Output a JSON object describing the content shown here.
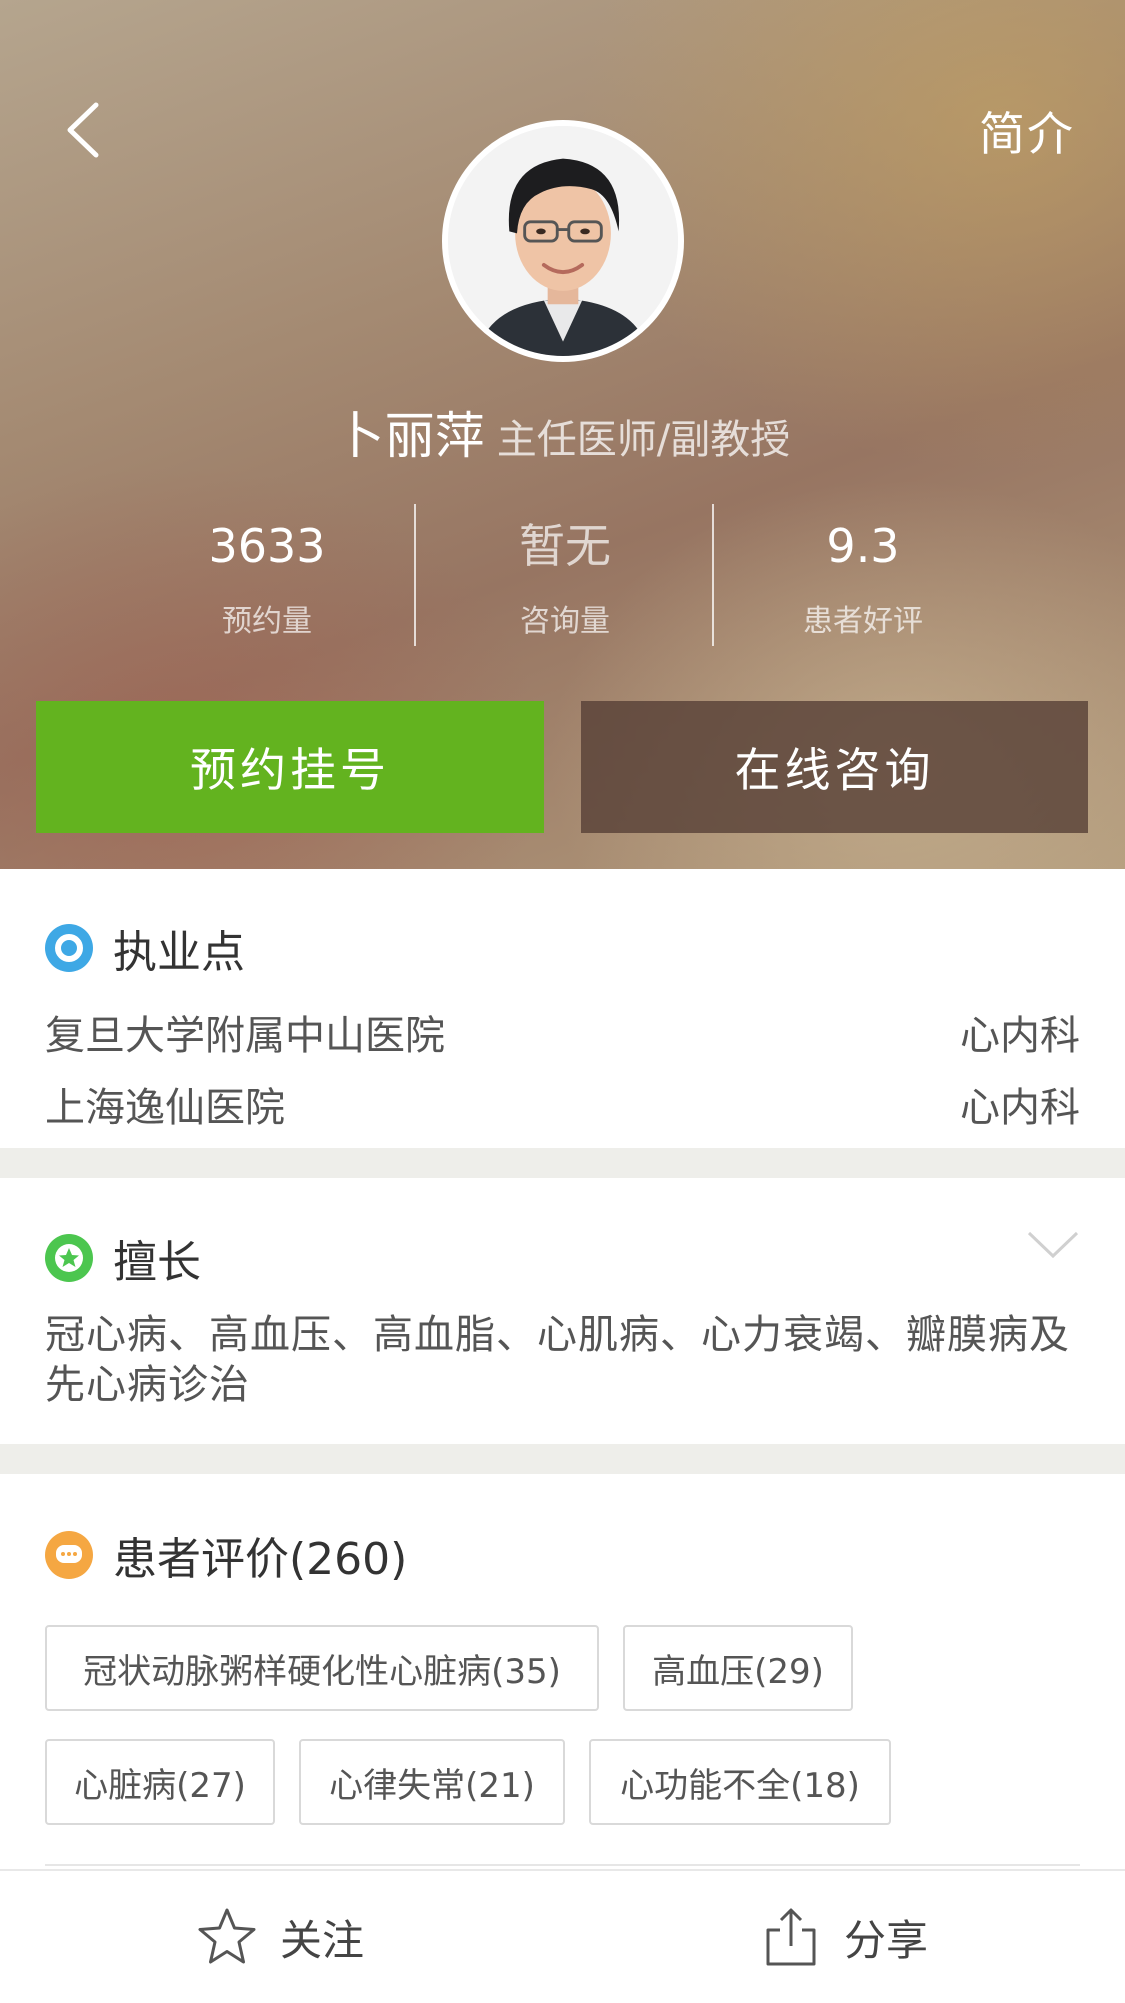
{
  "header": {
    "intro_label": "简介",
    "doctor_name": "卜丽萍",
    "doctor_title": "主任医师/副教授",
    "stats": [
      {
        "value": "3633",
        "label": "预约量"
      },
      {
        "value": "暂无",
        "label": "咨询量"
      },
      {
        "value": "9.3",
        "label": "患者好评"
      }
    ],
    "book_button": "预约挂号",
    "consult_button": "在线咨询"
  },
  "practice": {
    "title": "执业点",
    "items": [
      {
        "hospital": "复旦大学附属中山医院",
        "department": "心内科"
      },
      {
        "hospital": "上海逸仙医院",
        "department": "心内科"
      }
    ]
  },
  "specialty": {
    "title": "擅长",
    "text": "冠心病、高血压、高血脂、心肌病、心力衰竭、瓣膜病及先心病诊治"
  },
  "reviews": {
    "title": "患者评价(260)",
    "tags": [
      "冠状动脉粥样硬化性心脏病(35)",
      "高血压(29)",
      "心脏病(27)",
      "心律失常(21)",
      "心功能不全(18)"
    ]
  },
  "bottom_bar": {
    "follow_label": "关注",
    "share_label": "分享"
  },
  "colors": {
    "book_green": "#63b31f",
    "location_blue": "#3ea8e5",
    "specialty_green": "#4cc64f",
    "review_orange": "#f5a742"
  },
  "icons": {
    "back": "chevron-left-icon",
    "location": "location-pin-icon",
    "specialty": "star-badge-icon",
    "reviews": "chat-bubble-icon",
    "expand": "chevron-down-icon",
    "follow": "star-outline-icon",
    "share": "share-icon"
  }
}
